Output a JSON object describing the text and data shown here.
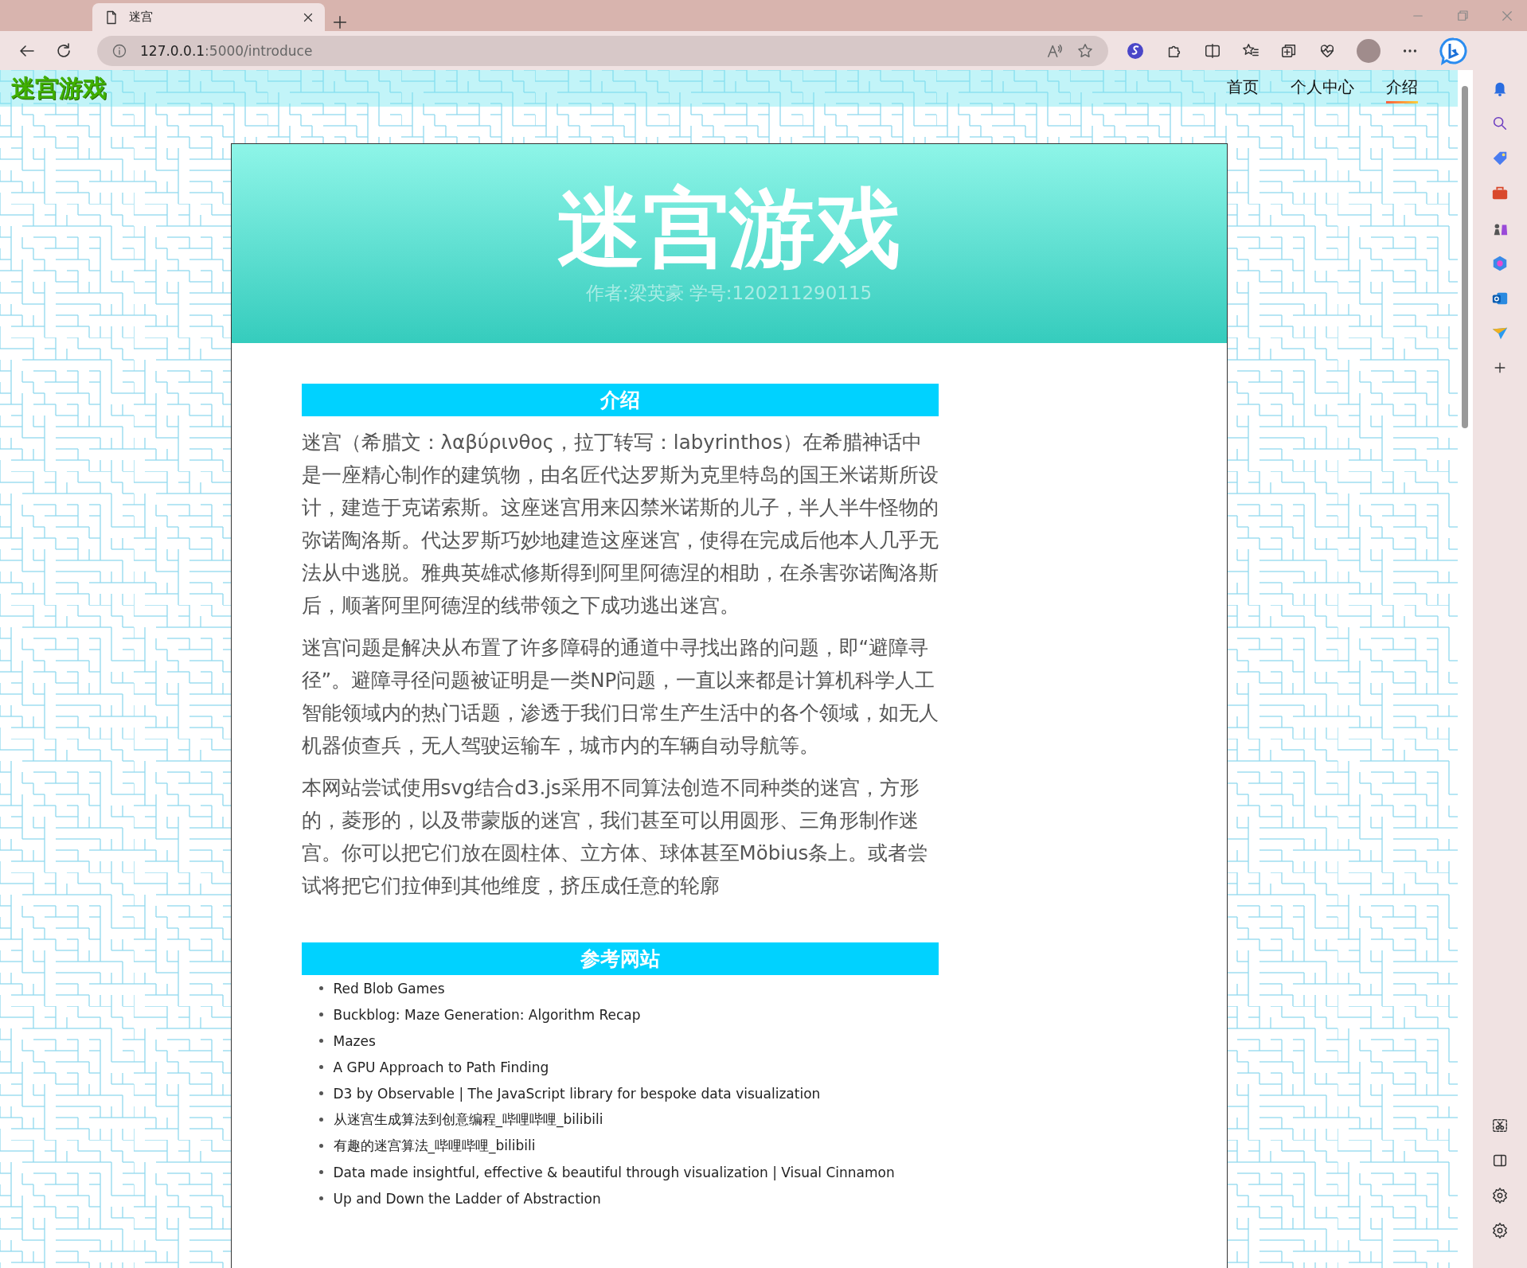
{
  "browser": {
    "tabs": [
      {
        "title": "迷宫",
        "selected": true
      }
    ],
    "url": {
      "host": "127.0.0.1",
      "path": ":5000/introduce"
    }
  },
  "site": {
    "logo": "迷宫游戏",
    "nav": [
      {
        "label": "首页",
        "selected": false
      },
      {
        "label": "个人中心",
        "selected": false
      },
      {
        "label": "介绍",
        "selected": true
      }
    ]
  },
  "header": {
    "title": "迷宫游戏",
    "subtitle": "作者:梁英豪 学号:120211290115"
  },
  "sections": [
    {
      "kind": "paragraphs",
      "heading": "介绍",
      "paragraphs": [
        "迷宫（希腊文：λαβύρινθος，拉丁转写：labyrinthos）在希腊神话中是一座精心制作的建筑物，由名匠代达罗斯为克里特岛的国王米诺斯所设计，建造于克诺索斯。这座迷宫用来囚禁米诺斯的儿子，半人半牛怪物的弥诺陶洛斯。代达罗斯巧妙地建造这座迷宫，使得在完成后他本人几乎无法从中逃脱。雅典英雄忒修斯得到阿里阿德涅的相助，在杀害弥诺陶洛斯后，顺著阿里阿德涅的线带领之下成功逃出迷宫。",
        "迷宫问题是解决从布置了许多障碍的通道中寻找出路的问题，即“避障寻径”。避障寻径问题被证明是一类NP问题，一直以来都是计算机科学人工智能领域内的热门话题，渗透于我们日常生产生活中的各个领域，如无人机器侦查兵，无人驾驶运输车，城市内的车辆自动导航等。",
        "本网站尝试使用svg结合d3.js采用不同算法创造不同种类的迷宫，方形的，菱形的，以及带蒙版的迷宫，我们甚至可以用圆形、三角形制作迷宫。你可以把它们放在圆柱体、立方体、球体甚至Möbius条上。或者尝试将把它们拉伸到其他维度，挤压成任意的轮廓"
      ]
    },
    {
      "kind": "links",
      "heading": "参考网站",
      "links": [
        "Red Blob Games",
        "Buckblog: Maze Generation: Algorithm Recap",
        "Mazes",
        "A GPU Approach to Path Finding",
        "D3 by Observable | The JavaScript library for bespoke data visualization",
        "从迷宫生成算法到创意编程_哔哩哔哩_bilibili",
        "有趣的迷宫算法_哔哩哔哩_bilibili",
        "Data made insightful, effective & beautiful through visualization | Visual Cinnamon",
        "Up and Down the Ladder of Abstraction"
      ]
    }
  ]
}
